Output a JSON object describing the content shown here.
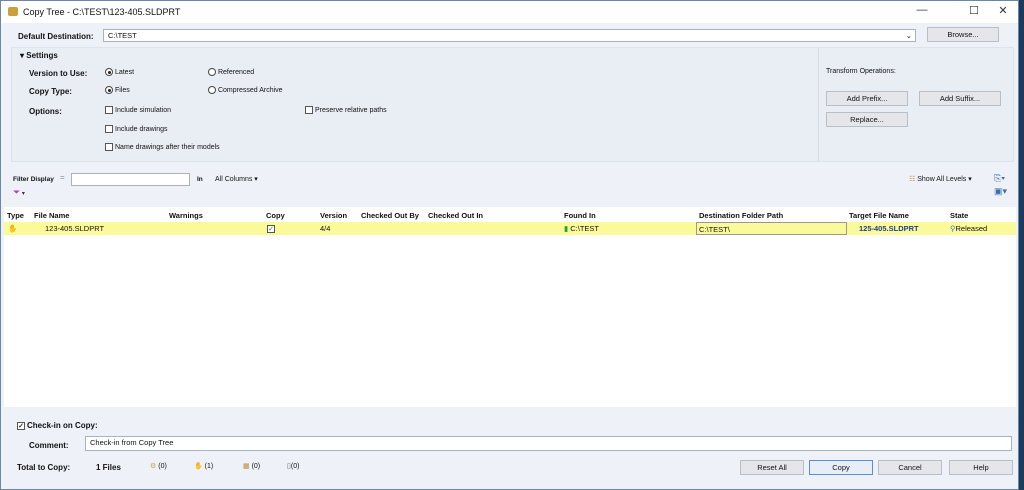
{
  "window": {
    "title": "Copy Tree - C:\\TEST\\123-405.SLDPRT",
    "minimize": "—",
    "maximize": "☐",
    "close": "✕"
  },
  "destination": {
    "label": "Default Destination:",
    "value": "C:\\TEST",
    "browse": "Browse..."
  },
  "settings": {
    "header": "Settings",
    "version_label": "Version to Use:",
    "version_options": [
      "Latest",
      "Referenced"
    ],
    "version_selected": "Latest",
    "copytype_label": "Copy Type:",
    "copytype_options": [
      "Files",
      "Compressed Archive"
    ],
    "copytype_selected": "Files",
    "options_label": "Options:",
    "options": [
      {
        "label": "Include simulation",
        "checked": false
      },
      {
        "label": "Include drawings",
        "checked": false
      },
      {
        "label": "Name drawings after their models",
        "checked": false
      },
      {
        "label": "Preserve relative paths",
        "checked": false
      }
    ]
  },
  "transform": {
    "label": "Transform Operations:",
    "add_prefix": "Add Prefix...",
    "add_suffix": "Add Suffix...",
    "replace": "Replace..."
  },
  "filter": {
    "label": "Filter Display",
    "eq": "=",
    "value": "",
    "in": "In",
    "columns": "All Columns",
    "show_levels": "Show All Levels"
  },
  "table": {
    "headers": [
      "Type",
      "File Name",
      "Warnings",
      "Copy",
      "Version",
      "Checked Out By",
      "Checked Out In",
      "Found In",
      "Destination Folder Path",
      "Target File Name",
      "State"
    ],
    "rows": [
      {
        "file_name": "123-405.SLDPRT",
        "warnings": "",
        "copy": true,
        "version": "4/4",
        "checked_out_by": "",
        "checked_out_in": "",
        "found_in": "C:\\TEST",
        "destination": "C:\\TEST\\",
        "target": "125-405.SLDPRT",
        "state": "Released"
      }
    ]
  },
  "bottom": {
    "checkin_label": "Check-in on Copy:",
    "checkin_checked": true,
    "comment_label": "Comment:",
    "comment": "Check-in from Copy Tree",
    "total_label": "Total to Copy:",
    "total": "1 Files",
    "counts": [
      "(0)",
      "(1)",
      "(0)",
      "(0)"
    ],
    "reset": "Reset All",
    "copy": "Copy",
    "cancel": "Cancel",
    "help": "Help"
  }
}
